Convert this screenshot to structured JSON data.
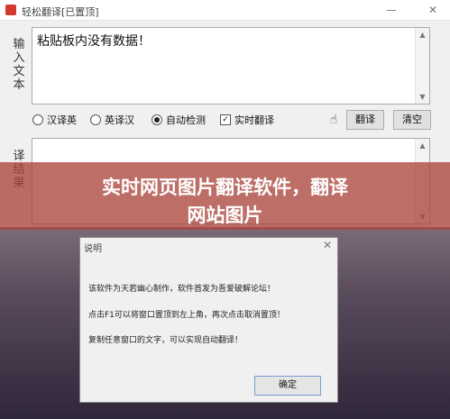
{
  "window": {
    "title": "轻松翻译[已置顶]",
    "minimize_glyph": "—",
    "maximize_glyph": "☐",
    "close_glyph": "✕"
  },
  "input": {
    "label": "输入文本",
    "content": "粘贴板内没有数据！"
  },
  "options": {
    "items": [
      {
        "label": "汉译英",
        "type": "radio",
        "selected": false
      },
      {
        "label": "英译汉",
        "type": "radio",
        "selected": false
      },
      {
        "label": "自动检测",
        "type": "radio",
        "selected": true
      },
      {
        "label": "实时翻译",
        "type": "checkbox",
        "checked": true
      }
    ],
    "hand_icon": "☝",
    "translate_button": "翻译",
    "clear_button": "清空"
  },
  "output": {
    "label": "译结果"
  },
  "banner": {
    "line1": "实时网页图片翻译软件，翻译",
    "line2": "网站图片"
  },
  "dialog": {
    "title": "说明",
    "close_glyph": "✕",
    "lines": [
      "该软件为天若幽心制作，软件首发为吾爱破解论坛！",
      "点击F1可以将窗口置顶到左上角，再次点击取消置顶！",
      "复制任意窗口的文字，可以实现自动翻译！"
    ],
    "ok_button": "确定"
  }
}
